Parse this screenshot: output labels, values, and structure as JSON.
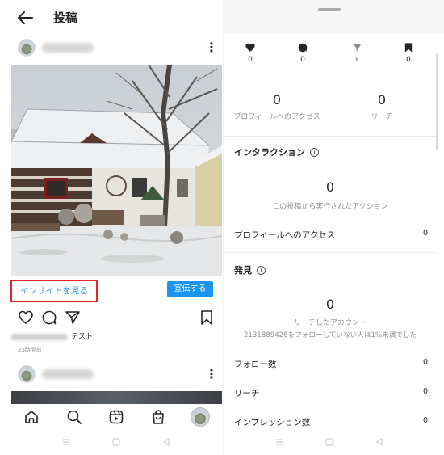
{
  "left_screen": {
    "header": {
      "title": "投稿"
    },
    "post": {
      "more_label": "⋮",
      "insight_button": "インサイトを見る",
      "promote_button": "宣伝する",
      "caption_text": "テスト",
      "timestamp": "23時間前"
    },
    "second_post": {
      "more_label": "⋮"
    }
  },
  "right_screen": {
    "stats": [
      {
        "icon": "heart-icon",
        "value": "0"
      },
      {
        "icon": "comment-icon",
        "value": "0"
      },
      {
        "icon": "send-icon",
        "value": "x"
      },
      {
        "icon": "bookmark-icon",
        "value": "0"
      }
    ],
    "profile_visits": {
      "value": "0",
      "label": "プロフィールへのアクセス"
    },
    "reach": {
      "value": "0",
      "label": "リーチ"
    },
    "interactions": {
      "title": "インタラクション",
      "value": "0",
      "caption": "この投稿から実行されたアクション",
      "row_label": "プロフィールへのアクセス",
      "row_value": "0"
    },
    "discovery": {
      "title": "発見",
      "value": "0",
      "caption1": "リーチしたアカウント",
      "caption2": "2131889426をフォローしていない人は1%未満でした",
      "rows": [
        {
          "label": "フォロー数",
          "value": "0"
        },
        {
          "label": "リーチ",
          "value": "0"
        },
        {
          "label": "インプレッション数",
          "value": "0"
        }
      ]
    }
  },
  "colors": {
    "accent_blue": "#3897f0",
    "promote_blue": "#1b95f0",
    "highlight_red": "#e0262a"
  }
}
